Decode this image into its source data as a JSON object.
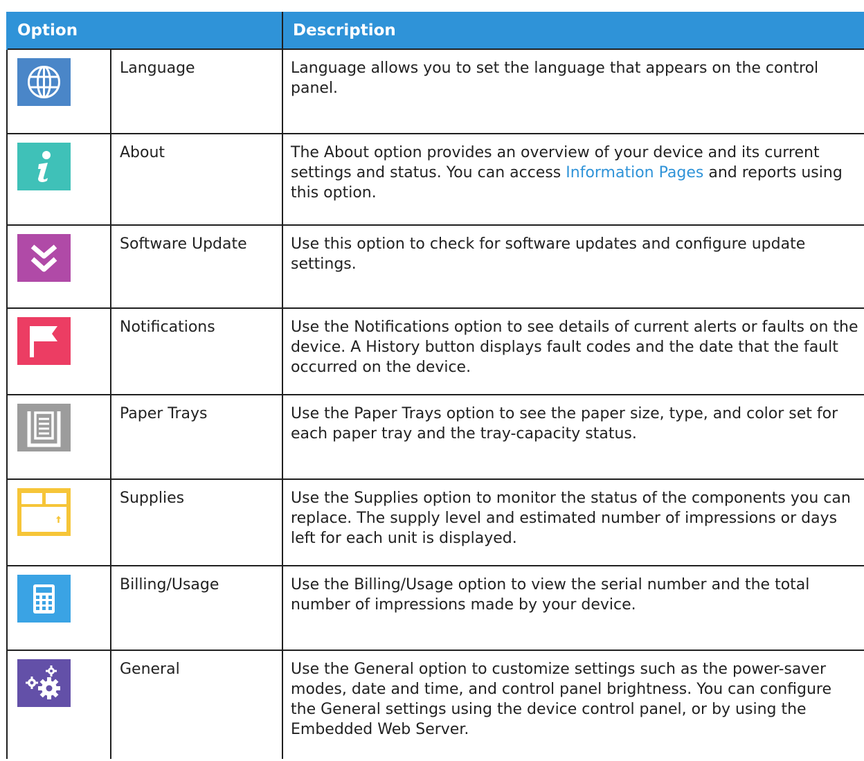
{
  "header": {
    "option": "Option",
    "description": "Description"
  },
  "rows": [
    {
      "icon": "globe-icon",
      "icon_color": "#4a86c8",
      "label": "Language",
      "description": "Language allows you to set the language that appears on the control panel."
    },
    {
      "icon": "info-icon",
      "icon_color": "#3fc1b8",
      "label": "About",
      "description_before": "The About option provides an overview of your device and its current settings and status. You can access ",
      "description_link": "Information Pages",
      "description_after": " and reports using this option."
    },
    {
      "icon": "software-update-icon",
      "icon_color": "#b04aa7",
      "label": "Software Update",
      "description": "Use this option to check for software updates and configure update settings."
    },
    {
      "icon": "flag-icon",
      "icon_color": "#ec3d63",
      "label": "Notifications",
      "description": "Use the Notifications option to see details of current alerts or faults on the device. A History button displays fault codes and the date that the fault occurred on the device."
    },
    {
      "icon": "paper-tray-icon",
      "icon_color": "#9c9c9c",
      "label": "Paper Trays",
      "description": "Use the Paper Trays option to see the paper size, type, and color set for each paper tray and the tray-capacity status."
    },
    {
      "icon": "supplies-box-icon",
      "icon_color": "#f6c538",
      "label": "Supplies",
      "description": "Use the Supplies option to monitor the status of the components you can replace. The supply level and estimated number of impressions or days left for each unit is displayed."
    },
    {
      "icon": "calculator-icon",
      "icon_color": "#3aa3e4",
      "label": "Billing/Usage",
      "description": "Use the Billing/Usage option to view the serial number and the total number of impressions made by your device."
    },
    {
      "icon": "gears-icon",
      "icon_color": "#6350a8",
      "label": "General",
      "description": "Use the General option to customize settings such as the power-saver modes, date and time, and control panel brightness. You can configure the General settings using the device control panel, or by using the Embedded Web Server."
    }
  ]
}
